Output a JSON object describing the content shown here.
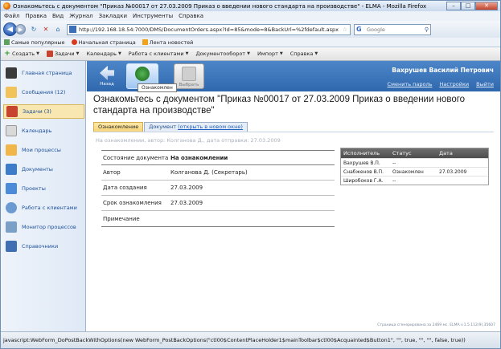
{
  "window": {
    "title": "Ознакомьтесь с документом \"Приказ №00017 от 27.03.2009 Приказ о введении нового стандарта на производстве\" - ELMA - Mozilla Firefox"
  },
  "menu": [
    "Файл",
    "Правка",
    "Вид",
    "Журнал",
    "Закладки",
    "Инструменты",
    "Справка"
  ],
  "nav": {
    "url": "http://192.168.18.54:7000/DMS/DocumentOrders.aspx?Id=85&mode=8&BackUrl=%2fdefault.aspx",
    "search_placeholder": "Google"
  },
  "bookmarks": [
    "Самые популярные",
    "Начальная страница",
    "Лента новостей"
  ],
  "app_toolbar": [
    "Создать",
    "Задачи",
    "Календарь",
    "Работа с клиентами",
    "Документооборот",
    "Импорт",
    "Справка"
  ],
  "sidebar": {
    "items": [
      {
        "label": "Главная страница"
      },
      {
        "label": "Сообщения (12)"
      },
      {
        "label": "Задачи (3)"
      },
      {
        "label": "Календарь"
      },
      {
        "label": "Мои процессы"
      },
      {
        "label": "Документы"
      },
      {
        "label": "Проекты"
      },
      {
        "label": "Работа с клиентами"
      },
      {
        "label": "Монитор процессов"
      },
      {
        "label": "Справочники"
      }
    ]
  },
  "main_toolbar": {
    "back_label": "Назад",
    "ack_tooltip": "Ознакомлен",
    "select_label": "Выбрать"
  },
  "user": {
    "name": "Вахрушев Василий Петрович",
    "links": [
      "Сменить пароль",
      "Настройки",
      "Выйти"
    ]
  },
  "document": {
    "title": "Ознакомьтесь с документом \"Приказ №00017 от 27.03.2009 Приказ о введении нового стандарта на производстве\""
  },
  "tabs": {
    "ack": "Ознакомление",
    "doc": "Документ",
    "doc_link": "(открыть в новом окне)"
  },
  "acq_line": "На ознакомлении, автор: Колганова Д., дата отправки: 27.03.2009",
  "props": [
    {
      "label": "Состояние документа",
      "value": "На ознакомлении"
    },
    {
      "label": "Автор",
      "value": "Колганова Д. (Секретарь)"
    },
    {
      "label": "Дата создания",
      "value": "27.03.2009"
    },
    {
      "label": "Срок ознакомления",
      "value": "27.03.2009"
    },
    {
      "label": "Примечание",
      "value": ""
    }
  ],
  "acq_table": {
    "headers": [
      "Исполнитель",
      "Статус",
      "Дата"
    ],
    "rows": [
      [
        "Вахрушев В.П.",
        "--",
        ""
      ],
      [
        "Снабженов В.П.",
        "Ознакомлен",
        "27.03.2009"
      ],
      [
        "Широбоков Г.А.",
        "--",
        ""
      ]
    ]
  },
  "footer_note": "Страница сгенерирована за 2469 мс. ELMA  v.1.5.112(9).35607",
  "status": "javascript:WebForm_DoPostBackWithOptions(new WebForm_PostBackOptions(\"ctl00$ContentPlaceHolder1$mainToolbar$ctl00$Acquainted$Button1\", \"\", true, \"\", \"\", false, true))"
}
